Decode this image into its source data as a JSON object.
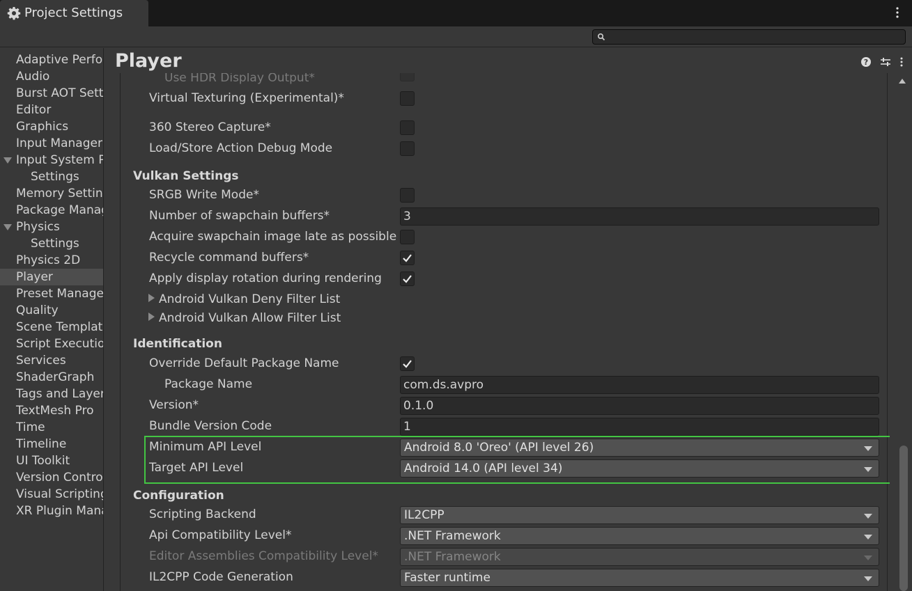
{
  "window": {
    "tab_title": "Project Settings"
  },
  "search": {
    "placeholder": ""
  },
  "sidebar": {
    "items": [
      {
        "label": "Adaptive Performance",
        "child": false,
        "foldout": false
      },
      {
        "label": "Audio",
        "child": false,
        "foldout": false
      },
      {
        "label": "Burst AOT Settings",
        "child": false,
        "foldout": false
      },
      {
        "label": "Editor",
        "child": false,
        "foldout": false
      },
      {
        "label": "Graphics",
        "child": false,
        "foldout": false
      },
      {
        "label": "Input Manager",
        "child": false,
        "foldout": false
      },
      {
        "label": "Input System Package",
        "child": false,
        "foldout": true
      },
      {
        "label": "Settings",
        "child": true,
        "foldout": false
      },
      {
        "label": "Memory Settings",
        "child": false,
        "foldout": false
      },
      {
        "label": "Package Manager",
        "child": false,
        "foldout": false
      },
      {
        "label": "Physics",
        "child": false,
        "foldout": true
      },
      {
        "label": "Settings",
        "child": true,
        "foldout": false
      },
      {
        "label": "Physics 2D",
        "child": false,
        "foldout": false
      },
      {
        "label": "Player",
        "child": false,
        "foldout": false,
        "selected": true
      },
      {
        "label": "Preset Manager",
        "child": false,
        "foldout": false
      },
      {
        "label": "Quality",
        "child": false,
        "foldout": false
      },
      {
        "label": "Scene Template",
        "child": false,
        "foldout": false
      },
      {
        "label": "Script Execution Order",
        "child": false,
        "foldout": false
      },
      {
        "label": "Services",
        "child": false,
        "foldout": false
      },
      {
        "label": "ShaderGraph",
        "child": false,
        "foldout": false
      },
      {
        "label": "Tags and Layers",
        "child": false,
        "foldout": false
      },
      {
        "label": "TextMesh Pro",
        "child": false,
        "foldout": false
      },
      {
        "label": "Time",
        "child": false,
        "foldout": false
      },
      {
        "label": "Timeline",
        "child": false,
        "foldout": false
      },
      {
        "label": "UI Toolkit",
        "child": false,
        "foldout": false
      },
      {
        "label": "Version Control",
        "child": false,
        "foldout": false
      },
      {
        "label": "Visual Scripting",
        "child": false,
        "foldout": false
      },
      {
        "label": "XR Plugin Management",
        "child": false,
        "foldout": false
      }
    ]
  },
  "main": {
    "title": "Player",
    "rows": {
      "hdr_display": {
        "label": "Use HDR Display Output*",
        "checked": false
      },
      "virtual_texturing": {
        "label": "Virtual Texturing (Experimental)*",
        "checked": false
      },
      "stereo_capture": {
        "label": "360 Stereo Capture*",
        "checked": false
      },
      "load_store_debug": {
        "label": "Load/Store Action Debug Mode",
        "checked": false
      },
      "vulkan_section": "Vulkan Settings",
      "srgb_write": {
        "label": "SRGB Write Mode*",
        "checked": false
      },
      "swapchain": {
        "label": "Number of swapchain buffers*",
        "value": "3"
      },
      "acquire_late": {
        "label": "Acquire swapchain image late as possible*",
        "checked": false
      },
      "recycle_buffers": {
        "label": "Recycle command buffers*",
        "checked": true
      },
      "display_rotation": {
        "label": "Apply display rotation during rendering",
        "checked": true
      },
      "deny_filter": "Android Vulkan Deny Filter List",
      "allow_filter": "Android Vulkan Allow Filter List",
      "identification_section": "Identification",
      "override_package": {
        "label": "Override Default Package Name",
        "checked": true
      },
      "package_name": {
        "label": "Package Name",
        "value": "com.ds.avpro"
      },
      "version": {
        "label": "Version*",
        "value": "0.1.0"
      },
      "bundle_version": {
        "label": "Bundle Version Code",
        "value": "1"
      },
      "min_api": {
        "label": "Minimum API Level",
        "value": "Android 8.0 'Oreo' (API level 26)"
      },
      "target_api": {
        "label": "Target API Level",
        "value": "Android 14.0 (API level 34)"
      },
      "configuration_section": "Configuration",
      "scripting_backend": {
        "label": "Scripting Backend",
        "value": "IL2CPP"
      },
      "api_compat": {
        "label": "Api Compatibility Level*",
        "value": ".NET Framework"
      },
      "editor_assemblies": {
        "label": "Editor Assemblies Compatibility Level*",
        "value": ".NET Framework"
      },
      "il2cpp_codegen": {
        "label": "IL2CPP Code Generation",
        "value": "Faster runtime"
      }
    }
  },
  "colors": {
    "highlight": "#43c543",
    "background": "#383838",
    "selected": "#4d4d4d"
  }
}
